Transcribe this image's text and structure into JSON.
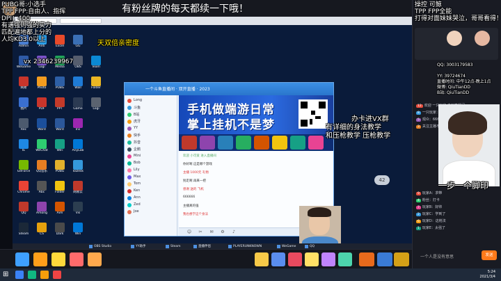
{
  "headline": "有粉丝牌的每天都续一下哦！",
  "overlay_left": [
    "PUBG哥:小选手",
    "TPP FPP:自由人、指挥",
    "DPI：400",
    "有遇强则强的实力",
    "匹配遍地都上分的",
    "人均KD3.0以上"
  ],
  "overlay_right": [
    "操控 可鲸",
    "TPP FPP全能",
    "打得对面妹妹哭泣，哥哥看得！"
  ],
  "overlay_promo": "天双倍亲密度",
  "overlay_vx": "vx",
  "overlay_vx_id": "2346239967",
  "overlay_right_mid": [
    "办卡进VX群",
    "有详细的身法教学",
    "和压枪教学 压枪教学"
  ],
  "right_panel_info": [
    "QQ: 3003179583",
    "YY: 39724674",
    "直播时间: 中午12点-晚上1点",
    "微博: QiuTianDD",
    "B站: QiuTianDD"
  ],
  "big_sub": "一步一个脚印",
  "app": {
    "title": "一个斗鱼直播间 · 双开直播 · 2023",
    "banner_line1": "手机做端游日常",
    "banner_line2": "掌上挂机不是梦"
  },
  "chat_lines": [
    "欢迎 小可爱 进入直播间",
    "你好啊 这是哪个游戏",
    "主播 1000元 礼物",
    "别走啊 再来一把",
    "感谢 送的 飞机",
    "666666",
    "主播真的强",
    "我也想学这个身法"
  ],
  "right_chat": [
    "欢迎 一只玩家 来到直播间",
    "一只玩家：主播真牛",
    "观众：666",
    "关注主播不迷路",
    "玩家A：求带",
    "粉丝：打卡",
    "玩家B：好帅",
    "玩家C：学到了",
    "玩家D：这枪法",
    "玩家E：太强了"
  ],
  "input_placeholder": "一个人是没有意思",
  "send_label": "发送",
  "badge42": "42",
  "taskbar_items": [
    "OBS Studio",
    "YY助手",
    "Steam",
    "直播伴侣",
    "PLAYERUNKNOWN",
    "WeGame",
    "QQ"
  ],
  "clock": {
    "time": "5:24",
    "date": "2021/3/4"
  }
}
